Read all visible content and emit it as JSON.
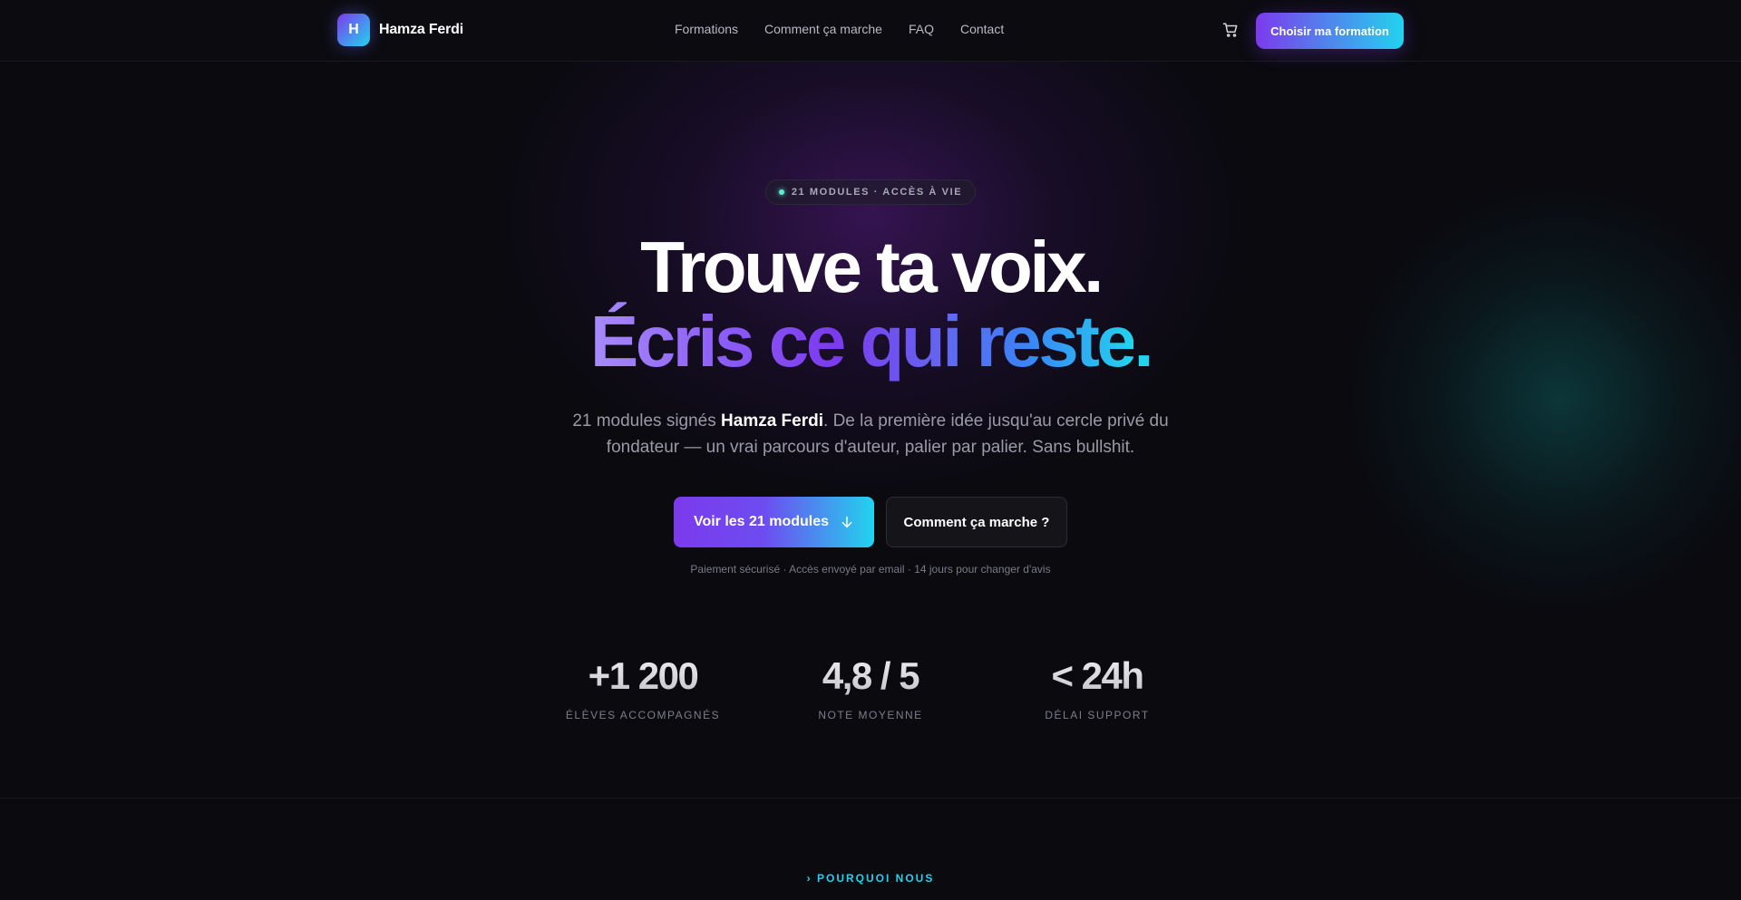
{
  "brand": {
    "logo_letter": "H",
    "name": "Hamza Ferdi"
  },
  "nav": {
    "items": [
      {
        "label": "Formations"
      },
      {
        "label": "Comment ça marche"
      },
      {
        "label": "FAQ"
      },
      {
        "label": "Contact"
      }
    ]
  },
  "header": {
    "cart_icon": "cart-icon",
    "cta_label": "Choisir ma formation"
  },
  "hero": {
    "badge": "21 MODULES · ACCÈS À VIE",
    "title_line1": "Trouve ta voix.",
    "title_line2": "Écris ce qui reste",
    "title_line2_dot": ".",
    "subtitle_before": "21 modules signés ",
    "subtitle_name": "Hamza Ferdi",
    "subtitle_after": ". De la première idée jusqu'au cercle privé du fondateur — un vrai parcours d'auteur, palier par palier. Sans bullshit.",
    "primary_cta": "Voir les 21 modules",
    "primary_cta_icon": "arrow-down-icon",
    "secondary_cta": "Comment ça marche ?",
    "reassurance": "Paiement sécurisé · Accès envoyé par email · 14 jours pour changer d'avis"
  },
  "stats": [
    {
      "value": "+1 200",
      "label": "ÉLÈVES ACCOMPAGNÉS"
    },
    {
      "value": "4,8 / 5",
      "label": "NOTE MOYENNE"
    },
    {
      "value": "< 24h",
      "label": "DÉLAI SUPPORT"
    }
  ],
  "next_section": {
    "tag": "› POURQUOI NOUS"
  },
  "colors": {
    "background": "#0a0a0f",
    "accent_purple": "#7c3aed",
    "accent_cyan": "#22d3ee",
    "badge_dot": "#5eead4"
  }
}
